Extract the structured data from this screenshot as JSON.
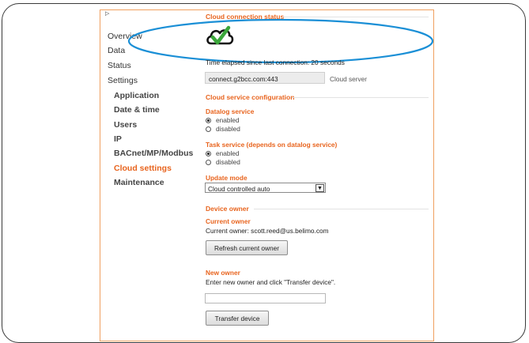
{
  "nav": {
    "items": [
      {
        "label": "Overview"
      },
      {
        "label": "Data"
      },
      {
        "label": "Status"
      },
      {
        "label": "Settings"
      },
      {
        "label": "Application"
      },
      {
        "label": "Date & time"
      },
      {
        "label": "Users"
      },
      {
        "label": "IP"
      },
      {
        "label": "BACnet/MP/Modbus"
      },
      {
        "label": "Cloud settings"
      },
      {
        "label": "Maintenance"
      }
    ],
    "active": "Cloud settings"
  },
  "status": {
    "title": "Cloud connection status",
    "status_icon": "cloud-check-icon",
    "elapsed_text": "Time elapsed since last connection: 20 seconds",
    "server_value": "connect.g2bcc.com:443",
    "server_label": "Cloud server"
  },
  "config": {
    "title": "Cloud service configuration",
    "datalog": {
      "title": "Datalog service",
      "options": [
        "enabled",
        "disabled"
      ],
      "selected": "enabled"
    },
    "task": {
      "title": "Task service (depends on datalog service)",
      "options": [
        "enabled",
        "disabled"
      ],
      "selected": "enabled"
    },
    "update_mode": {
      "title": "Update mode",
      "value": "Cloud controlled auto"
    }
  },
  "owner": {
    "title": "Device owner",
    "current_title": "Current owner",
    "current_text": "Current owner: scott.reed@us.belimo.com",
    "refresh_label": "Refresh current owner",
    "new_title": "New owner",
    "new_instruction": "Enter new owner and click \"Transfer device\".",
    "new_value": "",
    "transfer_label": "Transfer device"
  },
  "colors": {
    "accent": "#e8641e",
    "highlight": "#1a8fd6",
    "check": "#3aa63a"
  }
}
